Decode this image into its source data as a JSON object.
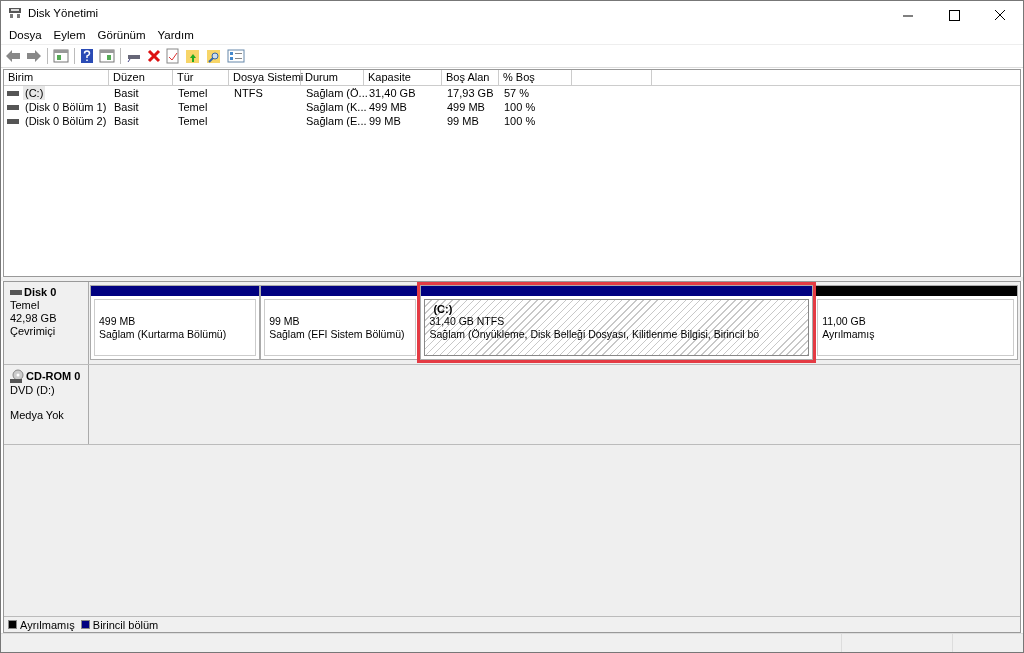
{
  "window": {
    "title": "Disk Yönetimi"
  },
  "menu": [
    "Dosya",
    "Eylem",
    "Görünüm",
    "Yardım"
  ],
  "table": {
    "columns": [
      "Birim",
      "Düzen",
      "Tür",
      "Dosya Sistemi",
      "Durum",
      "Kapasite",
      "Boş Alan",
      "% Boş"
    ],
    "rows": [
      {
        "selected": true,
        "cells": [
          "(C:)",
          "Basit",
          "Temel",
          "NTFS",
          "Sağlam (Ö...",
          "31,40 GB",
          "17,93 GB",
          "57 %"
        ]
      },
      {
        "selected": false,
        "cells": [
          "(Disk 0 Bölüm 1)",
          "Basit",
          "Temel",
          "",
          "Sağlam (K...",
          "499 MB",
          "499 MB",
          "100 %"
        ]
      },
      {
        "selected": false,
        "cells": [
          "(Disk 0 Bölüm 2)",
          "Basit",
          "Temel",
          "",
          "Sağlam (E...",
          "99 MB",
          "99 MB",
          "100 %"
        ]
      }
    ]
  },
  "disks": [
    {
      "kind": "disk",
      "name": "Disk 0",
      "lines": [
        "Temel",
        "42,98 GB",
        "Çevrimiçi"
      ],
      "partitions": [
        {
          "color": "#000080",
          "selected": false,
          "lines": [
            "499 MB",
            "Sağlam (Kurtarma Bölümü)"
          ]
        },
        {
          "color": "#000080",
          "selected": false,
          "lines": [
            "99 MB",
            "Sağlam (EFI Sistem Bölümü)"
          ]
        },
        {
          "color": "#000080",
          "selected": true,
          "title": "(C:)",
          "lines": [
            "31,40 GB NTFS",
            "Sağlam (Önyükleme, Disk Belleği Dosyası, Kilitlenme Bilgisi, Birincil bö"
          ]
        },
        {
          "color": "#000000",
          "selected": false,
          "lines": [
            "11,00 GB",
            "Ayrılmamış"
          ]
        }
      ]
    },
    {
      "kind": "cdrom",
      "name": "CD-ROM 0",
      "lines": [
        "DVD (D:)",
        "Medya Yok"
      ]
    }
  ],
  "legend": [
    {
      "color": "#000000",
      "label": "Ayrılmamış"
    },
    {
      "color": "#000080",
      "label": "Birincil bölüm"
    }
  ]
}
